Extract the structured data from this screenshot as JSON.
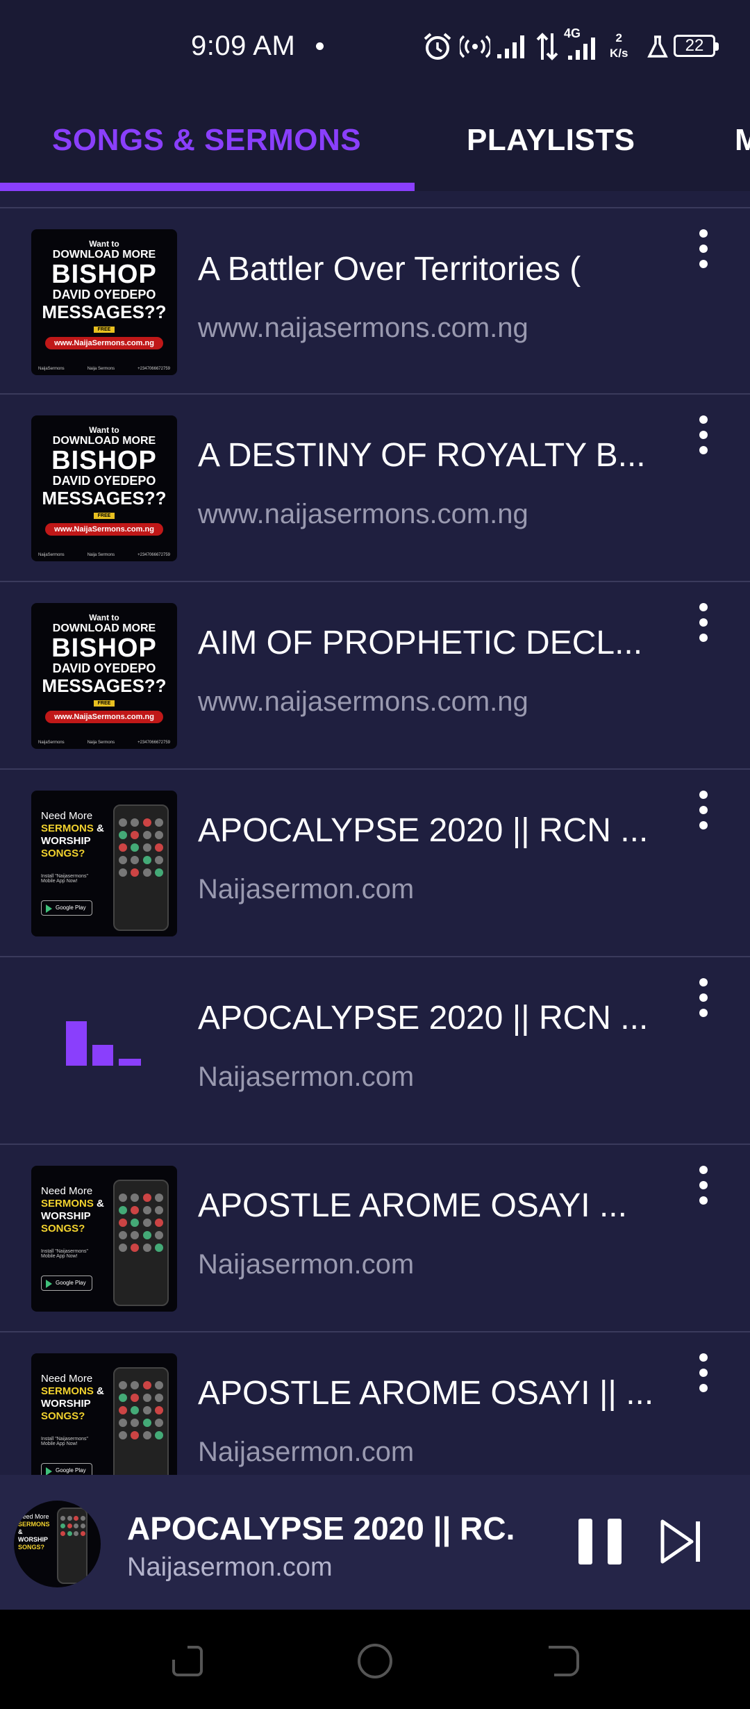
{
  "status_bar": {
    "time": "9:09 AM",
    "network_type": "4G",
    "speed_value": "2",
    "speed_unit": "K/s",
    "battery": "22",
    "icons": [
      "alarm-icon",
      "hotspot-icon",
      "signal-icon",
      "data-transfer-icon",
      "signal-icon",
      "lab-icon",
      "battery-icon"
    ]
  },
  "tabs": [
    {
      "label": "SONGS & SERMONS",
      "active": true
    },
    {
      "label": "PLAYLISTS",
      "active": false
    },
    {
      "label": "M",
      "active": false
    }
  ],
  "colors": {
    "accent": "#8a3ffc",
    "background": "#1f1f3f",
    "header": "#1a1a34",
    "player": "#252548",
    "subtitle": "#9a9ab0"
  },
  "artwork": {
    "bishop": {
      "l1": "Want to",
      "l2": "DOWNLOAD MORE",
      "l3": "BISHOP",
      "l4": "DAVID OYEDEPO",
      "l5": "MESSAGES??",
      "free": "FREE",
      "url": "www.NaijaSermons.com.ng",
      "foot": [
        "NaijaSermons",
        "Naija Sermons",
        "+2347066672759"
      ]
    },
    "app": {
      "line1": "Need More",
      "line2a": "SERMONS",
      "line2b": "&",
      "line3": "WORSHIP",
      "line4": "SONGS?",
      "install": "Install \"Naijasermons\" Mobile App Now!",
      "gplay": "Google Play"
    }
  },
  "items": [
    {
      "title": "A Battler Over Territories  (",
      "subtitle": "www.naijasermons.com.ng",
      "thumb": "bishop-poster"
    },
    {
      "title": "A DESTINY OF ROYALTY B...",
      "subtitle": "www.naijasermons.com.ng",
      "thumb": "bishop-poster"
    },
    {
      "title": "AIM OF PROPHETIC DECL...",
      "subtitle": "www.naijasermons.com.ng",
      "thumb": "bishop-poster"
    },
    {
      "title": "APOCALYPSE 2020 || RCN ...",
      "subtitle": "Naijasermon.com",
      "thumb": "app-promo"
    },
    {
      "title": "APOCALYPSE 2020 || RCN ...",
      "subtitle": "Naijasermon.com",
      "thumb": "placeholder-bars-icon"
    },
    {
      "title": "APOSTLE AROME OSAYI  ...",
      "subtitle": "Naijasermon.com",
      "thumb": "app-promo"
    },
    {
      "title": "APOSTLE AROME OSAYI || ...",
      "subtitle": "Naijasermon.com",
      "thumb": "app-promo"
    }
  ],
  "now_playing": {
    "title": "APOCALYPSE 2020 || RC..",
    "subtitle": "Naijasermon.com",
    "state": "playing"
  },
  "nav": [
    "recents-icon",
    "home-icon",
    "back-icon"
  ]
}
